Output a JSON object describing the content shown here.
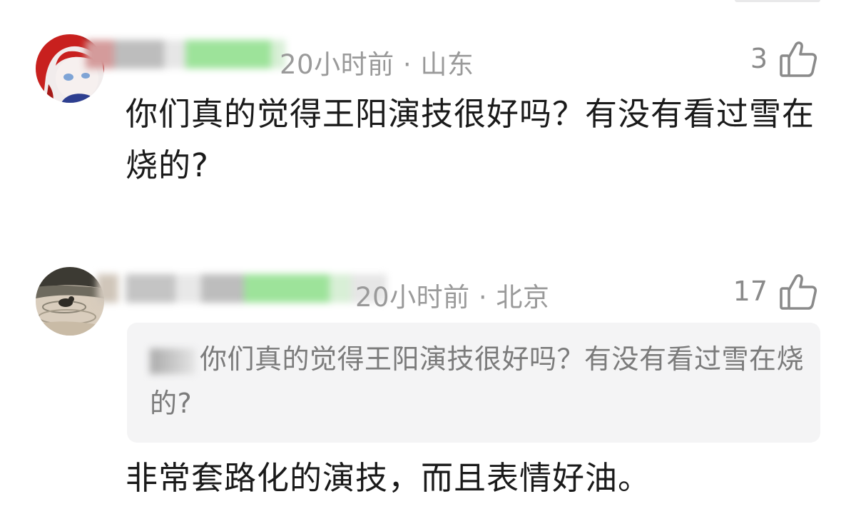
{
  "comments": [
    {
      "time": "20小时前",
      "location": "山东",
      "likes": "3",
      "text": "你们真的觉得王阳演技很好吗？有没有看过雪在烧的?"
    },
    {
      "time": "20小时前",
      "location": "北京",
      "likes": "17",
      "quote": "你们真的觉得王阳演技很好吗？有没有看过雪在烧的?",
      "text": "非常套路化的演技，而且表情好油。"
    }
  ],
  "separator": " · ",
  "icons": {
    "like": "thumbs-up-icon"
  },
  "colors": {
    "text": "#1a1a1a",
    "meta": "#9a9a9a",
    "quote_bg": "#f4f4f5",
    "quote_text": "#7b7b7b",
    "blur_green": "#9de39a"
  }
}
